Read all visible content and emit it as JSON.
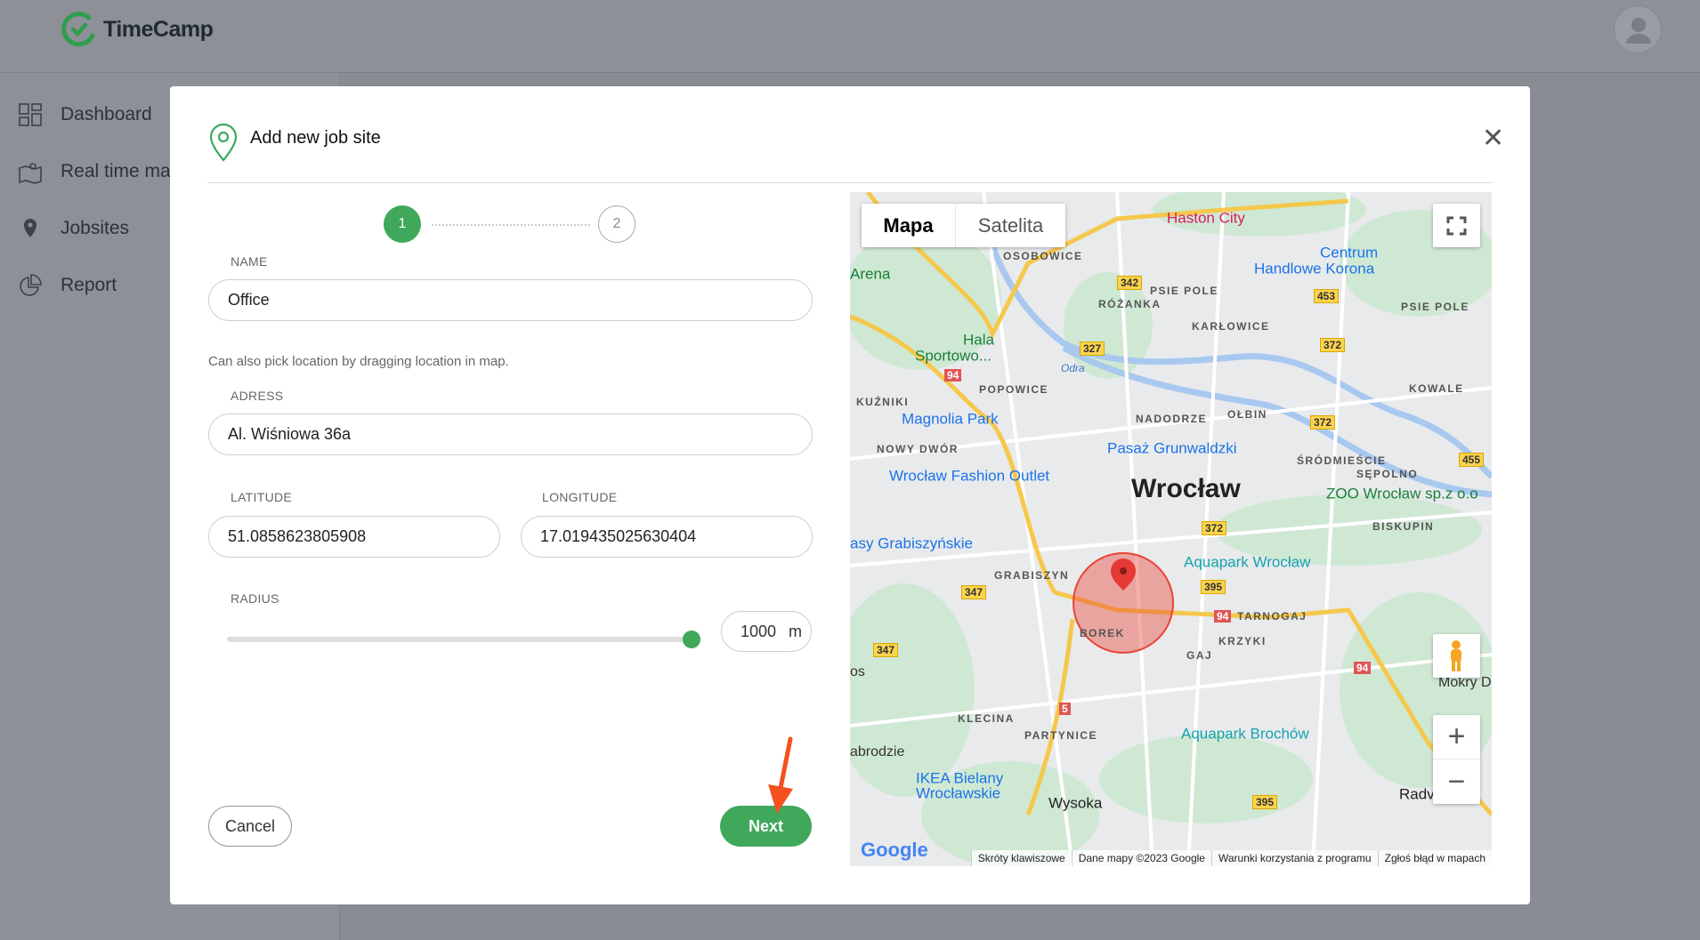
{
  "app": {
    "name": "TimeCamp"
  },
  "sidebar": {
    "items": [
      {
        "label": "Dashboard"
      },
      {
        "label": "Real time ma"
      },
      {
        "label": "Jobsites"
      },
      {
        "label": "Report"
      }
    ]
  },
  "modal": {
    "title": "Add new job site",
    "steps": [
      "1",
      "2"
    ],
    "name": {
      "label": "NAME",
      "value": "Office"
    },
    "helper": "Can also pick location by dragging location in map.",
    "address": {
      "label": "ADRESS",
      "value": "Al. Wiśniowa 36a"
    },
    "latitude": {
      "label": "LATITUDE",
      "value": "51.0858623805908"
    },
    "longitude": {
      "label": "LONGITUDE",
      "value": "17.019435025630404"
    },
    "radius": {
      "label": "RADIUS",
      "value": "1000",
      "unit": "m",
      "slider_fraction": 1.0
    },
    "cancel": "Cancel",
    "next": "Next"
  },
  "map": {
    "tabs": [
      "Mapa",
      "Satelita"
    ],
    "labels": {
      "haston": "Haston City",
      "centrum1": "Centrum",
      "centrum2": "Handlowe Korona",
      "osobowice": "OSOBOWICE",
      "arena": "Arena",
      "psiepole1": "PSIE POLE",
      "rozanka": "RÓŻANKA",
      "psiepole2": "PSIE POLE",
      "karlowice": "KARŁOWICE",
      "hala1": "Hala",
      "hala2": "Sportowo...",
      "odra": "Odra",
      "popowice": "POPOWICE",
      "kowale": "KOWALE",
      "kuzniki": "KUŹNIKI",
      "magnolia": "Magnolia Park",
      "nadodrze": "NADODRZE",
      "olbin": "OŁBIN",
      "pasaz": "Pasaż Grunwaldzki",
      "nowydwor": "NOWY DWÓR",
      "srodmiescie": "ŚRÓDMIEŚCIE",
      "sepolno": "SĘPOLNO",
      "fashion": "Wrocław Fashion Outlet",
      "wroclaw": "Wrocław",
      "zoo": "ZOO Wrocław sp.z o.o",
      "biskupin": "BISKUPIN",
      "grabiszynskie": "asy Grabiszyńskie",
      "aquapark": "Aquapark Wrocław",
      "grabiszyn": "GRABISZYN",
      "tarnogaj": "TARNOGAJ",
      "borek": "BOREK",
      "krzyki": "KRZYKI",
      "gaj": "GAJ",
      "os": "os",
      "mokry": "Mokry D",
      "klecina": "KLECINA",
      "partynice": "PARTYNICE",
      "brochow": "Aquapark Brochów",
      "abrodzie": "abrodzie",
      "ikea1": "IKEA Bielany",
      "ikea2": "Wrocławskie",
      "wysoka": "Wysoka",
      "radv": "Radv"
    },
    "shields": {
      "s342": "342",
      "s453": "453",
      "s327": "327",
      "s372a": "372",
      "s94a": "94",
      "s372b": "372",
      "s455": "455",
      "s372c": "372",
      "s395a": "395",
      "s347a": "347",
      "s94b": "94",
      "s347b": "347",
      "s94c": "94",
      "s5": "5",
      "s395b": "395"
    },
    "google": "Google",
    "attribution": [
      "Skróty klawiszowe",
      "Dane mapy ©2023 Google",
      "Warunki korzystania z programu",
      "Zgłoś błąd w mapach"
    ]
  },
  "colors": {
    "accent": "#3fa85b",
    "arrow": "#f4511e",
    "circle": "#ea4335"
  }
}
